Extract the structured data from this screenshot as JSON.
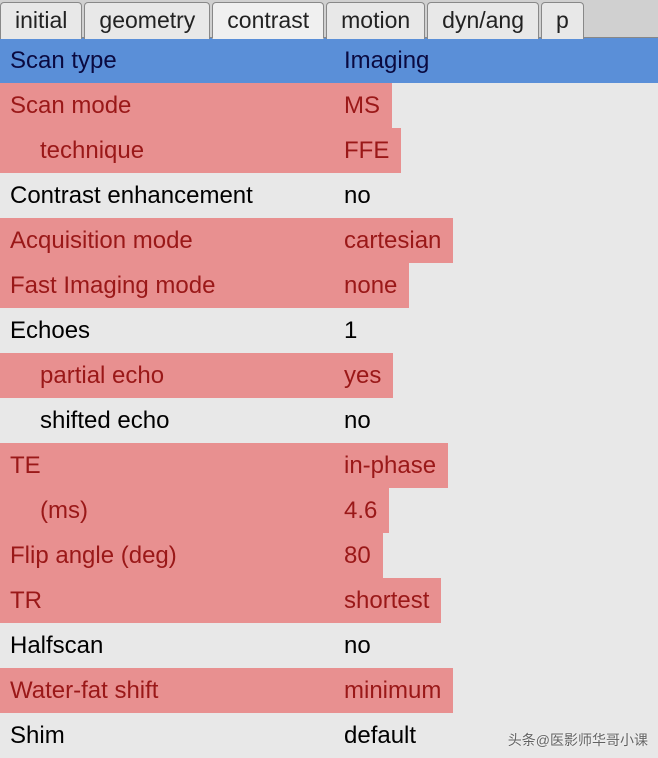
{
  "tabs": {
    "t0": "initial",
    "t1": "geometry",
    "t2": "contrast",
    "t3": "motion",
    "t4": "dyn/ang",
    "t5": "p"
  },
  "rows": {
    "scan_type": {
      "label": "Scan type",
      "value": "Imaging"
    },
    "scan_mode": {
      "label": "Scan mode",
      "value": "MS"
    },
    "technique": {
      "label": "technique",
      "value": "FFE"
    },
    "contrast_enhancement": {
      "label": "Contrast enhancement",
      "value": "no"
    },
    "acquisition_mode": {
      "label": "Acquisition mode",
      "value": "cartesian"
    },
    "fast_imaging_mode": {
      "label": "Fast Imaging mode",
      "value": "none"
    },
    "echoes": {
      "label": "Echoes",
      "value": "1"
    },
    "partial_echo": {
      "label": "partial echo",
      "value": "yes"
    },
    "shifted_echo": {
      "label": "shifted echo",
      "value": "no"
    },
    "te": {
      "label": "TE",
      "value": "in-phase"
    },
    "te_ms": {
      "label": "(ms)",
      "value": "4.6"
    },
    "flip_angle": {
      "label": "Flip angle (deg)",
      "value": "80"
    },
    "tr": {
      "label": "TR",
      "value": "shortest"
    },
    "halfscan": {
      "label": "Halfscan",
      "value": "no"
    },
    "water_fat_shift": {
      "label": "Water-fat shift",
      "value": "minimum"
    },
    "shim": {
      "label": "Shim",
      "value": "default"
    }
  },
  "watermark": "头条@医影师华哥小课"
}
